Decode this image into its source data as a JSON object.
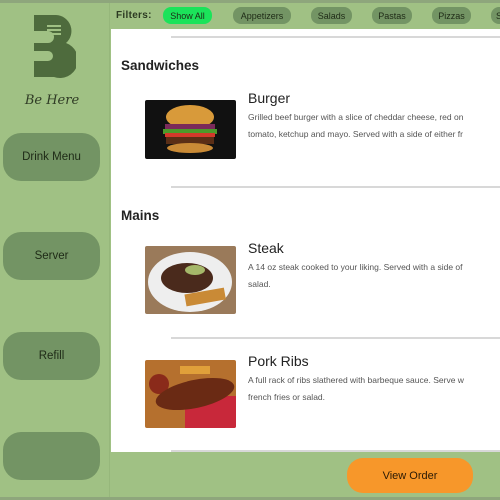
{
  "brand": {
    "name": "Be Here",
    "logo_letter": "B"
  },
  "sidebar": {
    "buttons": [
      {
        "label": "Drink Menu"
      },
      {
        "label": "Server"
      },
      {
        "label": "Refill"
      },
      {
        "label": ""
      }
    ]
  },
  "filters": {
    "label": "Filters:",
    "items": [
      {
        "label": "Show All",
        "active": true
      },
      {
        "label": "Appetizers"
      },
      {
        "label": "Salads"
      },
      {
        "label": "Pastas"
      },
      {
        "label": "Pizzas"
      },
      {
        "label": "S"
      }
    ]
  },
  "colors": {
    "sidebar": "#a0c184",
    "button": "#739464",
    "active_filter": "#1be35a",
    "view_order": "#f7972a"
  },
  "menu": {
    "sections": [
      {
        "title": "Sandwiches",
        "items": [
          {
            "name": "Burger",
            "desc_lines": [
              "Grilled beef burger with a slice of cheddar cheese, red on",
              "tomato, ketchup and mayo. Served with a side of either fr"
            ]
          }
        ]
      },
      {
        "title": "Mains",
        "items": [
          {
            "name": "Steak",
            "desc_lines": [
              "A 14 oz steak cooked to your liking. Served with a side of",
              "salad."
            ]
          },
          {
            "name": "Pork Ribs",
            "desc_lines": [
              "A full rack of ribs slathered with barbeque sauce. Serve w",
              "french fries or salad."
            ]
          }
        ]
      }
    ]
  },
  "footer": {
    "view_order": "View Order"
  }
}
